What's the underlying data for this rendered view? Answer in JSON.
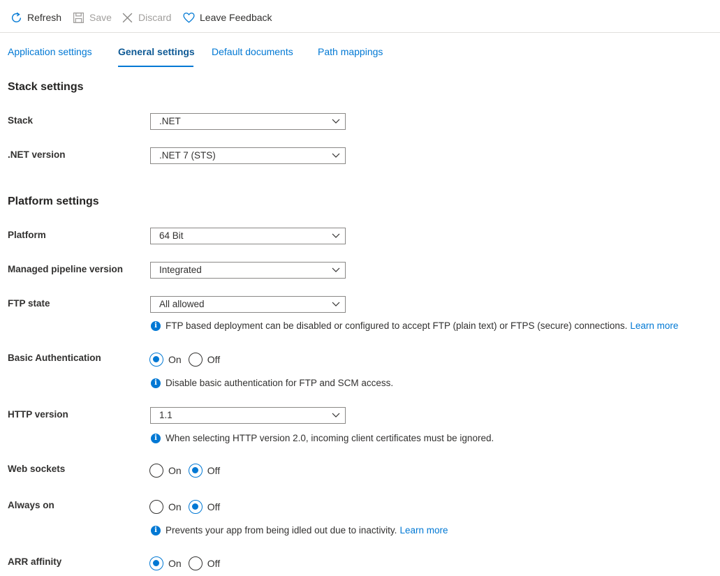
{
  "toolbar": {
    "refresh": "Refresh",
    "save": "Save",
    "discard": "Discard",
    "feedback": "Leave Feedback"
  },
  "tabs": [
    {
      "label": "Application settings",
      "active": false
    },
    {
      "label": "General settings",
      "active": true
    },
    {
      "label": "Default documents",
      "active": false
    },
    {
      "label": "Path mappings",
      "active": false
    }
  ],
  "stack_settings": {
    "title": "Stack settings",
    "stack": {
      "label": "Stack",
      "value": ".NET"
    },
    "net_version": {
      "label": ".NET version",
      "value": ".NET 7 (STS)"
    }
  },
  "platform_settings": {
    "title": "Platform settings",
    "platform": {
      "label": "Platform",
      "value": "64 Bit"
    },
    "pipeline": {
      "label": "Managed pipeline version",
      "value": "Integrated"
    },
    "ftp": {
      "label": "FTP state",
      "value": "All allowed",
      "info": "FTP based deployment can be disabled or configured to accept FTP (plain text) or FTPS (secure) connections.",
      "link": "Learn more"
    },
    "basic_auth": {
      "label": "Basic Authentication",
      "selected": "On",
      "on_label": "On",
      "off_label": "Off",
      "info": "Disable basic authentication for FTP and SCM access."
    },
    "http_version": {
      "label": "HTTP version",
      "value": "1.1",
      "info": "When selecting HTTP version 2.0, incoming client certificates must be ignored."
    },
    "web_sockets": {
      "label": "Web sockets",
      "selected": "Off",
      "on_label": "On",
      "off_label": "Off"
    },
    "always_on": {
      "label": "Always on",
      "selected": "Off",
      "on_label": "On",
      "off_label": "Off",
      "info": "Prevents your app from being idled out due to inactivity.",
      "link": "Learn more"
    },
    "arr_affinity": {
      "label": "ARR affinity",
      "selected": "On",
      "on_label": "On",
      "off_label": "Off"
    }
  },
  "colors": {
    "accent": "#0078d4",
    "text": "#323130",
    "disabled": "#a19f9d"
  }
}
